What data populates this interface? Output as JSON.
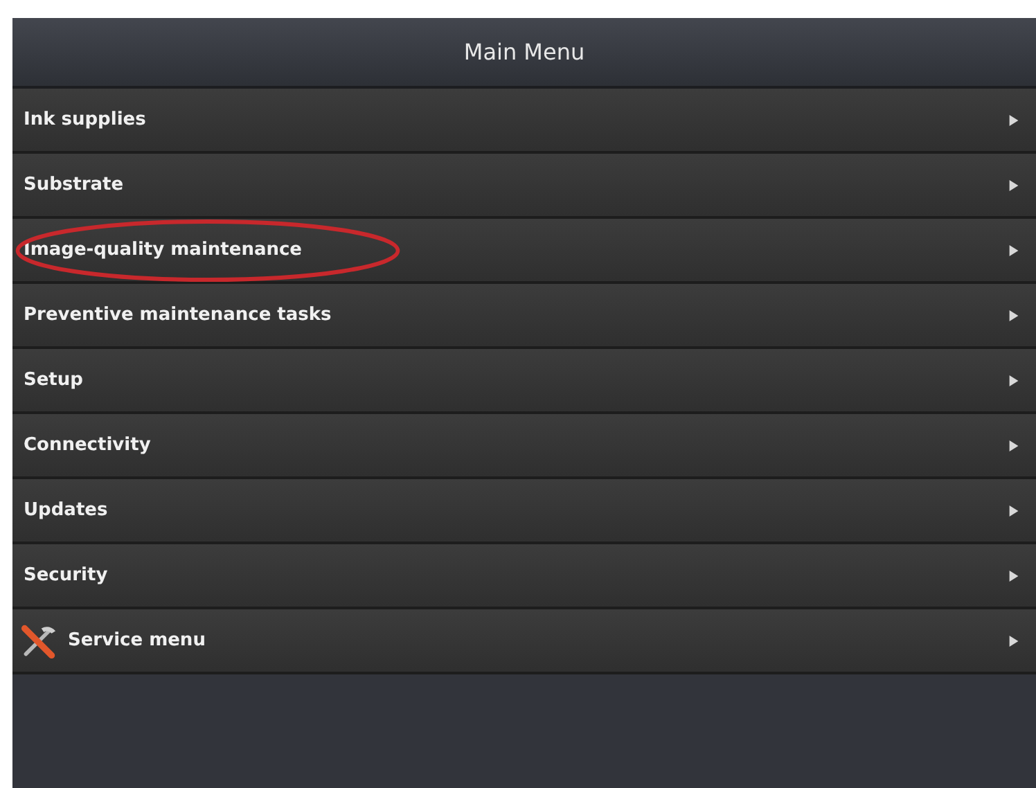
{
  "header": {
    "title": "Main Menu"
  },
  "menu_items": [
    {
      "label": "Ink supplies",
      "kind": "plain",
      "circled": false
    },
    {
      "label": "Substrate",
      "kind": "plain",
      "circled": false
    },
    {
      "label": "Image-quality maintenance",
      "kind": "plain",
      "circled": true
    },
    {
      "label": "Preventive maintenance tasks",
      "kind": "plain",
      "circled": false
    },
    {
      "label": "Setup",
      "kind": "plain",
      "circled": false
    },
    {
      "label": "Connectivity",
      "kind": "plain",
      "circled": false
    },
    {
      "label": "Updates",
      "kind": "plain",
      "circled": false
    },
    {
      "label": "Security",
      "kind": "plain",
      "circled": false
    },
    {
      "label": "Service menu",
      "kind": "tools",
      "circled": false
    }
  ]
}
